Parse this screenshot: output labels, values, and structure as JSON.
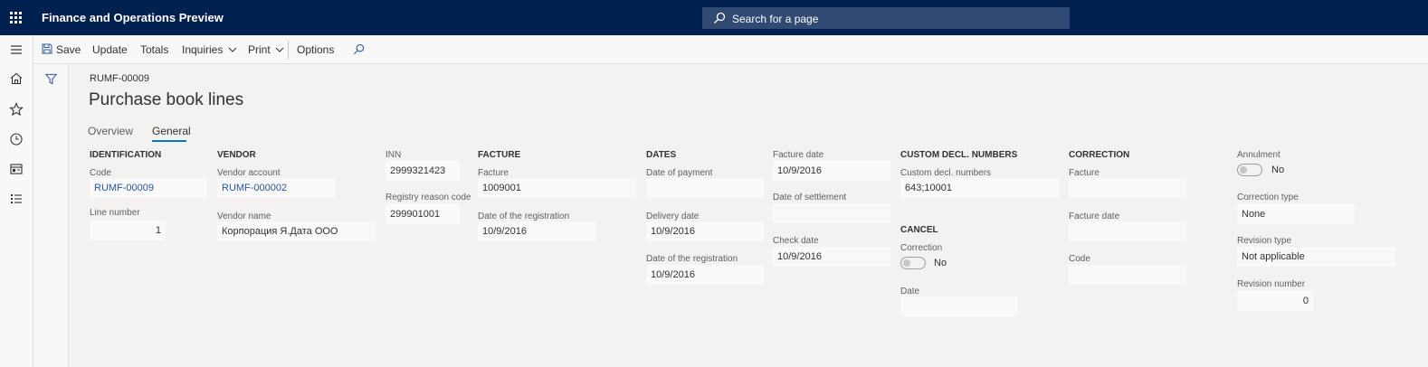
{
  "app": {
    "title": "Finance and Operations Preview"
  },
  "search": {
    "placeholder": "Search for a page"
  },
  "actionbar": {
    "save": "Save",
    "update": "Update",
    "totals": "Totals",
    "inquiries": "Inquiries",
    "print": "Print",
    "options": "Options"
  },
  "header": {
    "record_id": "RUMF-00009",
    "title": "Purchase book lines"
  },
  "tabs": {
    "overview": "Overview",
    "general": "General"
  },
  "identification": {
    "title": "IDENTIFICATION",
    "code_label": "Code",
    "code_value": "RUMF-00009",
    "line_label": "Line number",
    "line_value": "1"
  },
  "vendor": {
    "title": "VENDOR",
    "account_label": "Vendor account",
    "account_value": "RUMF-000002",
    "name_label": "Vendor name",
    "name_value": "Корпорация Я.Дата ООО"
  },
  "inn": {
    "label": "INN",
    "value": "2999321423",
    "reason_label": "Registry reason code",
    "reason_value": "299901001"
  },
  "facture": {
    "title": "FACTURE",
    "facture_label": "Facture",
    "facture_value": "1009001",
    "reg_label": "Date of the registration",
    "reg_value": "10/9/2016"
  },
  "dates": {
    "title": "DATES",
    "payment_label": "Date of payment",
    "payment_value": "",
    "delivery_label": "Delivery date",
    "delivery_value": "10/9/2016",
    "reg_label": "Date of the registration",
    "reg_value": "10/9/2016",
    "facture_date_label": "Facture date",
    "facture_date_value": "10/9/2016",
    "settlement_label": "Date of settlement",
    "settlement_value": "",
    "check_label": "Check date",
    "check_value": "10/9/2016"
  },
  "custom": {
    "title": "CUSTOM DECL. NUMBERS",
    "label": "Custom decl. numbers",
    "value": "643;10001"
  },
  "cancel": {
    "title": "CANCEL",
    "correction_label": "Correction",
    "correction_value": "No",
    "date_label": "Date",
    "date_value": ""
  },
  "correction": {
    "title": "CORRECTION",
    "facture_label": "Facture",
    "facture_value": "",
    "facture_date_label": "Facture date",
    "facture_date_value": "",
    "code_label": "Code",
    "code_value": ""
  },
  "annulment": {
    "label": "Annulment",
    "value": "No",
    "type_label": "Correction type",
    "type_value": "None",
    "revision_type_label": "Revision type",
    "revision_type_value": "Not applicable",
    "revision_number_label": "Revision number",
    "revision_number_value": "0"
  },
  "colors": {
    "topbar": "#002050",
    "search": "#304a74",
    "accent": "#0078d4",
    "link": "#2b579a"
  },
  "icons": [
    "waffle-icon",
    "search-icon",
    "hamburger-icon",
    "home-icon",
    "star-icon",
    "clock-icon",
    "workspace-icon",
    "list-icon",
    "save-icon",
    "filter-icon",
    "chevron-down-icon"
  ]
}
